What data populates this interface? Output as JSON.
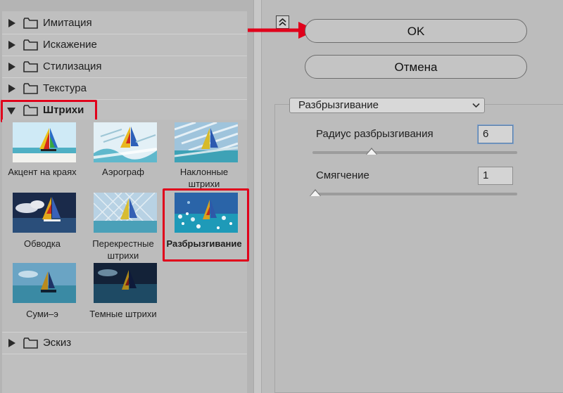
{
  "filter_gallery": {
    "folders_top": [
      {
        "label": "Имитация"
      },
      {
        "label": "Искажение"
      },
      {
        "label": "Стилизация"
      },
      {
        "label": "Текстура"
      }
    ],
    "open_folder": {
      "label": "Штрихи"
    },
    "thumbnails": [
      {
        "label": "Акцент на краях",
        "selected": false
      },
      {
        "label": "Аэрограф",
        "selected": false
      },
      {
        "label": "Наклонные штрихи",
        "selected": false
      },
      {
        "label": "Обводка",
        "selected": false
      },
      {
        "label": "Перекрестные штрихи",
        "selected": false
      },
      {
        "label": "Разбрызгивание",
        "selected": true
      },
      {
        "label": "Суми–э",
        "selected": false
      },
      {
        "label": "Темные штрихи",
        "selected": false
      }
    ],
    "folders_bottom": [
      {
        "label": "Эскиз"
      }
    ]
  },
  "buttons": {
    "ok": "OK",
    "cancel": "Отмена"
  },
  "settings": {
    "filter_select": "Разбрызгивание",
    "spray_radius": {
      "label": "Радиус разбрызгивания",
      "value": "6",
      "level": 0.29
    },
    "smoothness": {
      "label": "Смягчение",
      "value": "1",
      "level": 0.0
    }
  },
  "annotations": {
    "highlight_color": "#e0001b",
    "arrow_color": "#e0001b"
  }
}
